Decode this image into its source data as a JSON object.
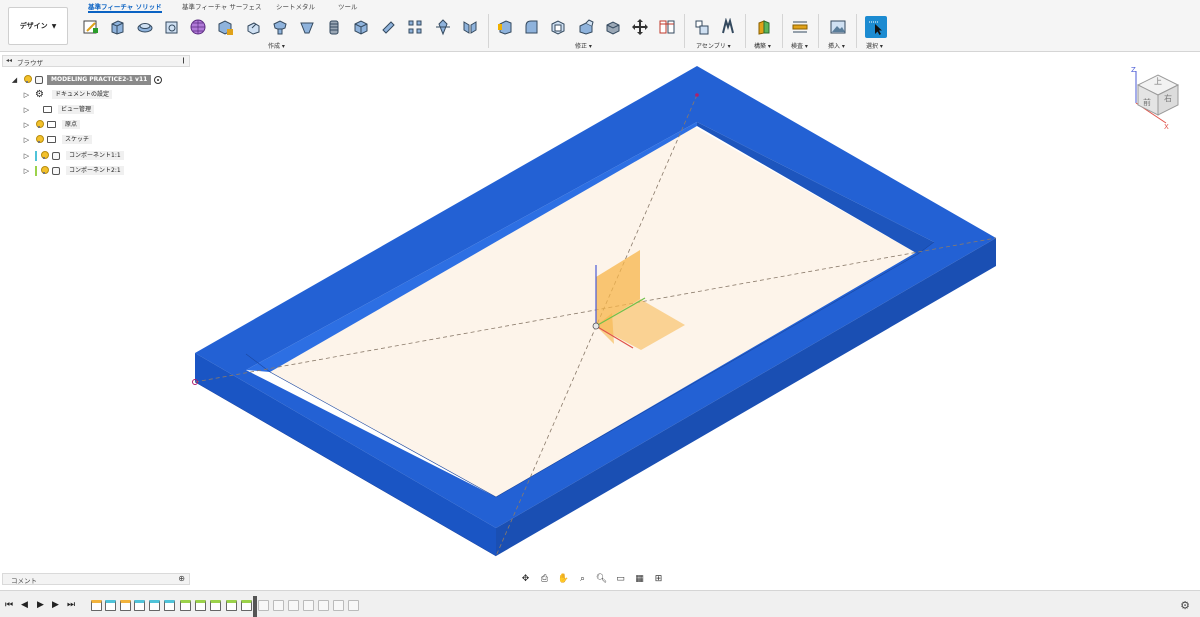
{
  "workspace": {
    "label": "デザイン"
  },
  "tabs": [
    {
      "label": "基準フィーチャ ソリッド",
      "active": true
    },
    {
      "label": "基準フィーチャ サーフェス",
      "active": false
    },
    {
      "label": "シートメタル",
      "active": false
    },
    {
      "label": "ツール",
      "active": false
    }
  ],
  "toolbar_groups": {
    "create": "作成 ▾",
    "modify": "修正 ▾",
    "assemble": "アセンブリ ▾",
    "construct": "構築 ▾",
    "inspect": "検査 ▾",
    "insert": "挿入 ▾",
    "select": "選択 ▾"
  },
  "browser": {
    "title": "ブラウザ",
    "root": "MODELING PRACTICE2-1 v11",
    "items": [
      {
        "label": "ドキュメントの設定",
        "type": "settings"
      },
      {
        "label": "ビュー管理",
        "type": "folder"
      },
      {
        "label": "原点",
        "type": "folder"
      },
      {
        "label": "スケッチ",
        "type": "folder"
      },
      {
        "label": "コンポーネント1:1",
        "type": "component",
        "color": "#4fc3d9"
      },
      {
        "label": "コンポーネント2:1",
        "type": "component",
        "color": "#9bd24a"
      }
    ]
  },
  "comments": {
    "label": "コメント"
  },
  "viewcube": {
    "top": "上",
    "front": "前",
    "right": "右"
  },
  "colors": {
    "accent": "#0a62c3",
    "frame": "#1f5fcf",
    "plane": "#fdf4ea"
  }
}
